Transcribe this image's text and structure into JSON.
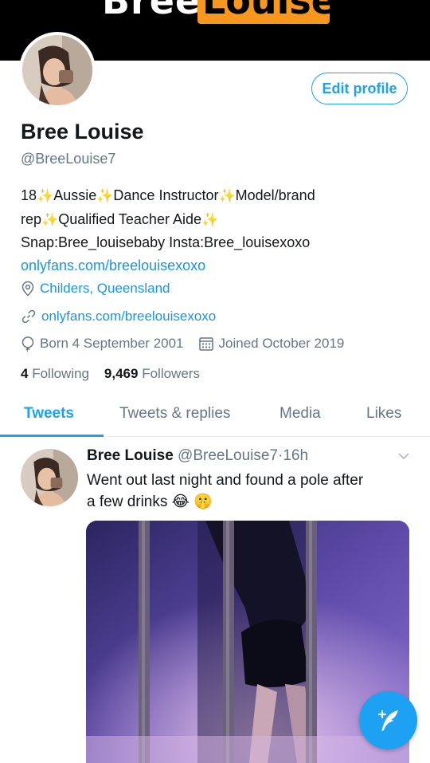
{
  "banner": {
    "text_white": "Bree",
    "text_on_orange": "Louise",
    "accent_color": "#f7971d"
  },
  "profile": {
    "edit_button": "Edit profile",
    "name": "Bree Louise",
    "handle": "@BreeLouise7",
    "bio": {
      "line1": [
        "18",
        "Aussie",
        "Dance Instructor",
        "Model/brand"
      ],
      "line2": [
        "rep",
        "Qualified Teacher Aide"
      ],
      "line3": "Snap:Bree_louisebaby Insta:Bree_louisexoxo",
      "link": "onlyfans.com/breelouisexoxo"
    },
    "location": "Childers, Queensland",
    "website": "onlyfans.com/breelouisexoxo",
    "born": "Born 4 September 2001",
    "joined": "Joined October 2019",
    "following_count": "4",
    "following_label": "Following",
    "followers_count": "9,469",
    "followers_label": "Followers"
  },
  "tabs": [
    {
      "label": "Tweets",
      "active": true
    },
    {
      "label": "Tweets & replies",
      "active": false
    },
    {
      "label": "Media",
      "active": false
    },
    {
      "label": "Likes",
      "active": false
    }
  ],
  "tweet": {
    "name": "Bree Louise",
    "handle": "@BreeLouise7",
    "separator": "·",
    "time": "16h",
    "text_line1": "Went out last night and found a pole after",
    "text_line2": "a few drinks",
    "emojis": [
      "😂",
      "🤫"
    ]
  },
  "icons": {
    "location": "location-pin-icon",
    "link": "link-icon",
    "birthday": "balloon-icon",
    "calendar": "calendar-icon",
    "caret": "chevron-down-icon",
    "compose": "compose-tweet-icon"
  },
  "colors": {
    "accent": "#1da1f2",
    "link": "#1b95e0",
    "secondary_text": "#657786"
  }
}
